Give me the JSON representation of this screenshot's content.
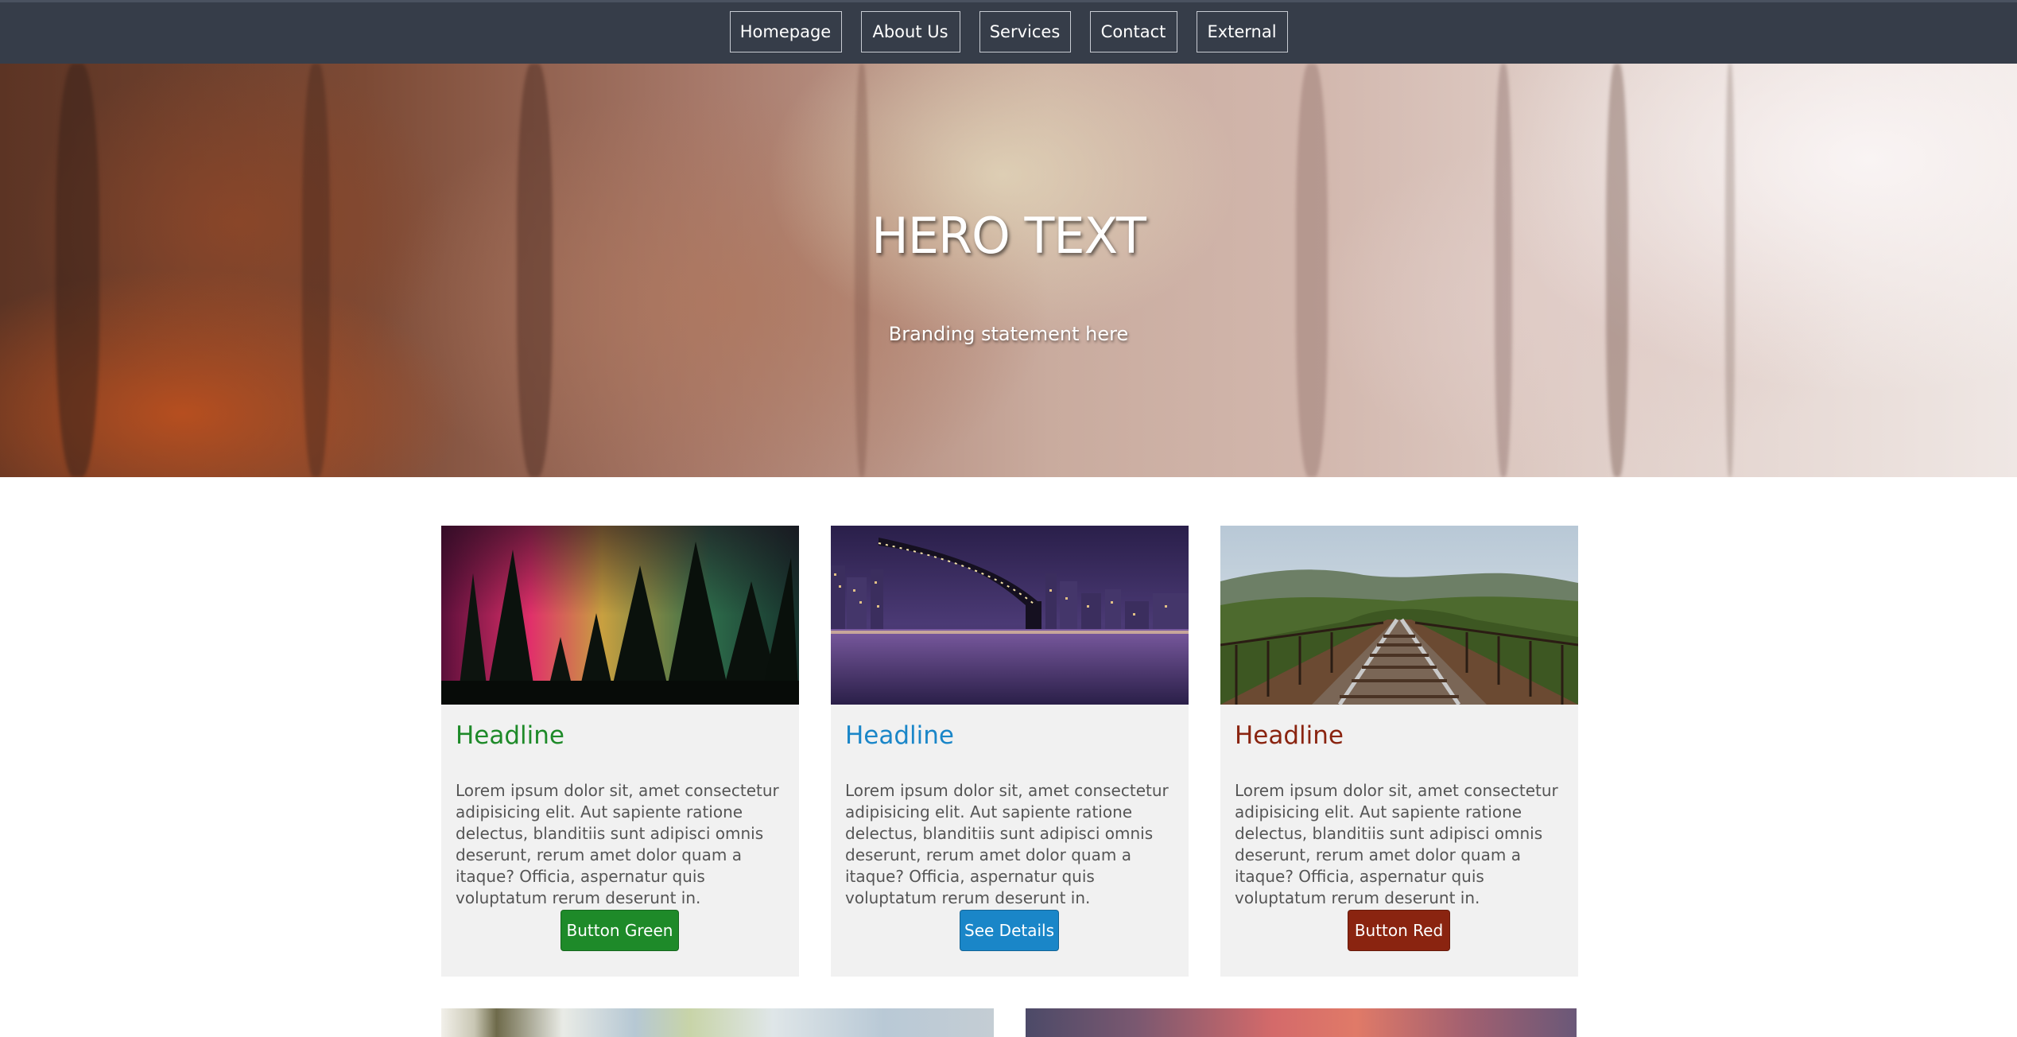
{
  "nav": {
    "items": [
      {
        "label": "Homepage"
      },
      {
        "label": "About Us"
      },
      {
        "label": "Services"
      },
      {
        "label": "Contact"
      },
      {
        "label": "External"
      }
    ]
  },
  "hero": {
    "title": "HERO TEXT",
    "subtitle": "Branding statement here"
  },
  "cards": [
    {
      "headline": "Headline",
      "text": "Lorem ipsum dolor sit, amet consectetur adipisicing elit. Aut sapiente ratione delectus, blanditiis sunt adipisci omnis deserunt, rerum amet dolor quam a itaque? Officia, aspernatur quis voluptatum rerum deserunt in.",
      "button": "Button Green",
      "accent": "#1e8a29"
    },
    {
      "headline": "Headline",
      "text": "Lorem ipsum dolor sit, amet consectetur adipisicing elit. Aut sapiente ratione delectus, blanditiis sunt adipisci omnis deserunt, rerum amet dolor quam a itaque? Officia, aspernatur quis voluptatum rerum deserunt in.",
      "button": "See Details",
      "accent": "#1a86c8"
    },
    {
      "headline": "Headline",
      "text": "Lorem ipsum dolor sit, amet consectetur adipisicing elit. Aut sapiente ratione delectus, blanditiis sunt adipisci omnis deserunt, rerum amet dolor quam a itaque? Officia, aspernatur quis voluptatum rerum deserunt in.",
      "button": "Button Red",
      "accent": "#8a2410"
    }
  ],
  "colors": {
    "nav_bg": "#363d49",
    "page_bg": "#ffffff",
    "card_bg": "#f1f1f1"
  }
}
